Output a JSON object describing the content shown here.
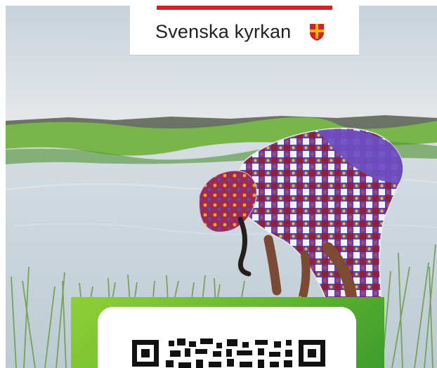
{
  "branding": {
    "organization_name": "Svenska kyrkan",
    "logo_icon": "cross-shield-icon",
    "logo_wordmark": "act-wordmark",
    "accent_red": "#d52027",
    "accent_yellow": "#f7b500",
    "text_color": "#222222"
  },
  "hero": {
    "image_icon": "woman-planting-rice-photo",
    "water_color": "#c9d6dc",
    "grass_color": "#6cab3f",
    "sky_color": "#d7dde3"
  },
  "donation": {
    "qr_icon": "qr-code-icon",
    "panel_green": "#5fb32d"
  }
}
